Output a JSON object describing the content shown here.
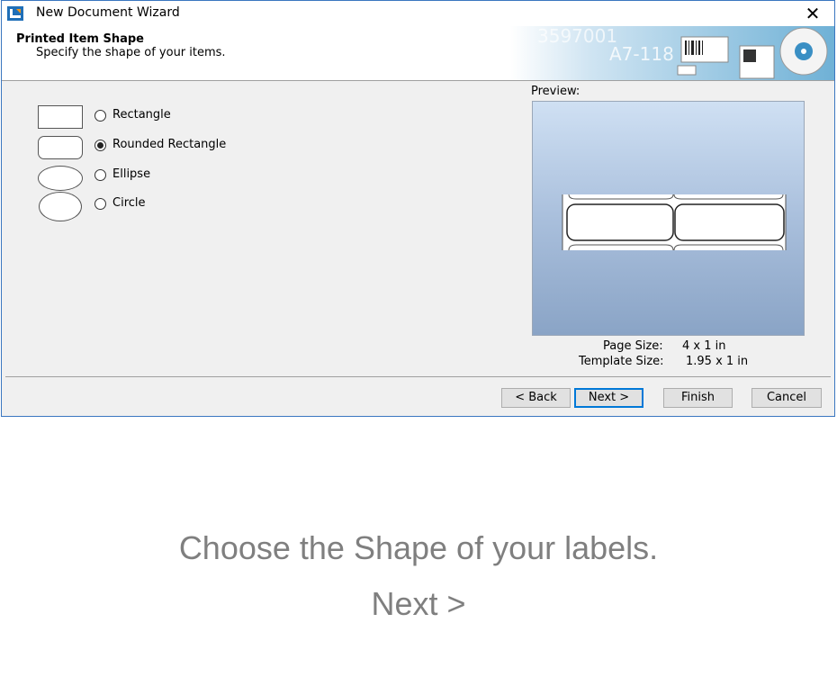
{
  "window": {
    "title": "New Document Wizard"
  },
  "header": {
    "title": "Printed Item Shape",
    "subtitle": "Specify the shape of your items.",
    "banner_text": "A7-118"
  },
  "shapes": [
    {
      "label": "Rectangle",
      "selected": false
    },
    {
      "label": "Rounded Rectangle",
      "selected": true
    },
    {
      "label": "Ellipse",
      "selected": false
    },
    {
      "label": "Circle",
      "selected": false
    }
  ],
  "preview": {
    "label": "Preview:",
    "page_size_label": "Page Size:",
    "page_size_value": "4 x 1 in",
    "template_size_label": "Template Size:",
    "template_size_value": "1.95 x 1 in"
  },
  "buttons": {
    "back": "< Back",
    "next": "Next >",
    "finish": "Finish",
    "cancel": "Cancel"
  },
  "caption": {
    "line1": "Choose the Shape of your labels.",
    "line2": "Next >"
  },
  "colors": {
    "accent": "#0078d7",
    "caption": "#7f7f7f"
  }
}
